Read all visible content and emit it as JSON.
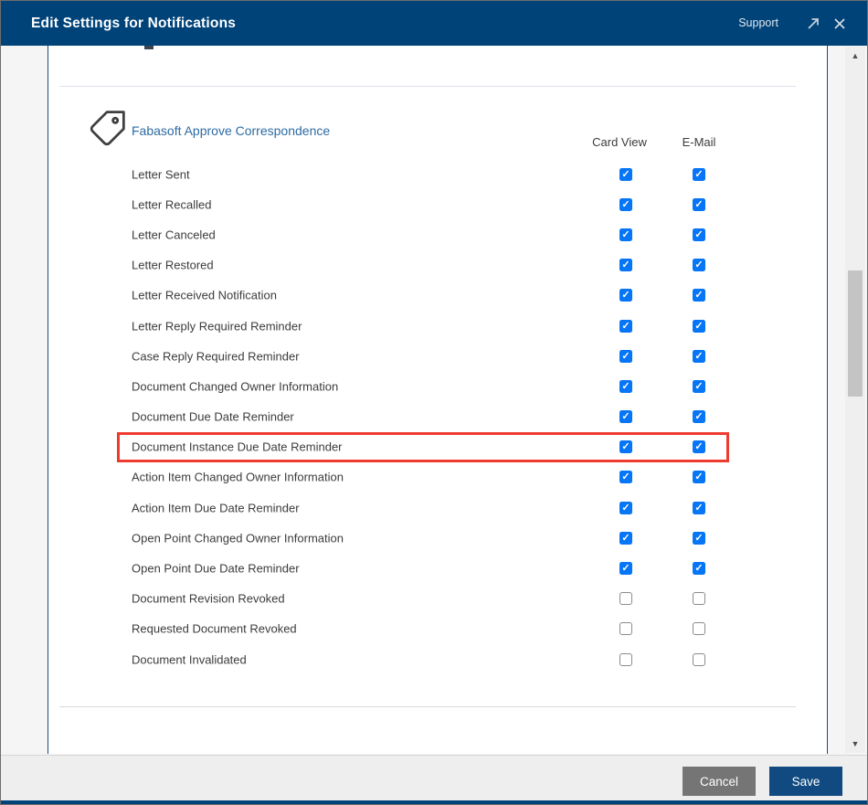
{
  "titlebar": {
    "title": "Edit Settings for Notifications",
    "support_label": "Support"
  },
  "section": {
    "heading": "Fabasoft Approve Correspondence",
    "columns": [
      "Card View",
      "E-Mail"
    ],
    "rows": [
      {
        "label": "Letter Sent",
        "card_view": true,
        "email": true,
        "highlighted": false
      },
      {
        "label": "Letter Recalled",
        "card_view": true,
        "email": true,
        "highlighted": false
      },
      {
        "label": "Letter Canceled",
        "card_view": true,
        "email": true,
        "highlighted": false
      },
      {
        "label": "Letter Restored",
        "card_view": true,
        "email": true,
        "highlighted": false
      },
      {
        "label": "Letter Received Notification",
        "card_view": true,
        "email": true,
        "highlighted": false
      },
      {
        "label": "Letter Reply Required Reminder",
        "card_view": true,
        "email": true,
        "highlighted": false
      },
      {
        "label": "Case Reply Required Reminder",
        "card_view": true,
        "email": true,
        "highlighted": false
      },
      {
        "label": "Document Changed Owner Information",
        "card_view": true,
        "email": true,
        "highlighted": false
      },
      {
        "label": "Document Due Date Reminder",
        "card_view": true,
        "email": true,
        "highlighted": false
      },
      {
        "label": "Document Instance Due Date Reminder",
        "card_view": true,
        "email": true,
        "highlighted": true
      },
      {
        "label": "Action Item Changed Owner Information",
        "card_view": true,
        "email": true,
        "highlighted": false
      },
      {
        "label": "Action Item Due Date Reminder",
        "card_view": true,
        "email": true,
        "highlighted": false
      },
      {
        "label": "Open Point Changed Owner Information",
        "card_view": true,
        "email": true,
        "highlighted": false
      },
      {
        "label": "Open Point Due Date Reminder",
        "card_view": true,
        "email": true,
        "highlighted": false
      },
      {
        "label": "Document Revision Revoked",
        "card_view": false,
        "email": false,
        "highlighted": false
      },
      {
        "label": "Requested Document Revoked",
        "card_view": false,
        "email": false,
        "highlighted": false
      },
      {
        "label": "Document Invalidated",
        "card_view": false,
        "email": false,
        "highlighted": false
      }
    ]
  },
  "scrollbar": {
    "up_glyph": "▲",
    "down_glyph": "▼"
  },
  "checkbox": {
    "check_glyph": "✓"
  },
  "footer": {
    "cancel_label": "Cancel",
    "save_label": "Save"
  },
  "colors": {
    "titlebar_bg": "#004379",
    "save_button_blue": "#114a80",
    "cancel_button_gray": "#757575",
    "heading_link_blue": "#2d6ba3",
    "checkbox_checked_blue": "#0675f6",
    "highlight_red": "#ee3b30",
    "panel_border_blue": "#1c4b7c"
  }
}
